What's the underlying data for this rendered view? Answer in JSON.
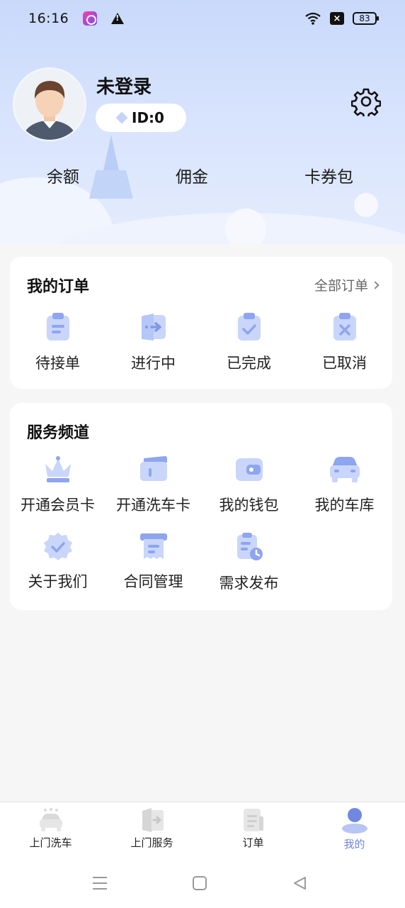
{
  "status": {
    "time": "16:16",
    "battery": "83"
  },
  "profile": {
    "username": "未登录",
    "id_label": "ID:0"
  },
  "stats": [
    {
      "label": "余额"
    },
    {
      "label": "佣金"
    },
    {
      "label": "卡券包"
    }
  ],
  "orders": {
    "title": "我的订单",
    "more_label": "全部订单",
    "items": [
      {
        "label": "待接单",
        "icon": "clipboard-list-icon"
      },
      {
        "label": "进行中",
        "icon": "door-arrow-icon"
      },
      {
        "label": "已完成",
        "icon": "clipboard-check-icon"
      },
      {
        "label": "已取消",
        "icon": "clipboard-x-icon"
      }
    ]
  },
  "services": {
    "title": "服务频道",
    "items": [
      {
        "label": "开通会员卡",
        "icon": "crown-icon"
      },
      {
        "label": "开通洗车卡",
        "icon": "card-icon"
      },
      {
        "label": "我的钱包",
        "icon": "wallet-icon"
      },
      {
        "label": "我的车库",
        "icon": "car-icon"
      },
      {
        "label": "关于我们",
        "icon": "badge-check-icon"
      },
      {
        "label": "合同管理",
        "icon": "contract-icon"
      },
      {
        "label": "需求发布",
        "icon": "document-clock-icon"
      }
    ]
  },
  "tabs": [
    {
      "label": "上门洗车",
      "icon": "car-wash-icon",
      "active": false
    },
    {
      "label": "上门服务",
      "icon": "service-door-icon",
      "active": false
    },
    {
      "label": "订单",
      "icon": "order-list-icon",
      "active": false
    },
    {
      "label": "我的",
      "icon": "person-icon",
      "active": true
    }
  ],
  "colors": {
    "accent": "#6f86d9",
    "icon_primary": "#8ea5ef",
    "icon_light": "#c9d6fa",
    "header_bg": "#d7e3fd"
  }
}
